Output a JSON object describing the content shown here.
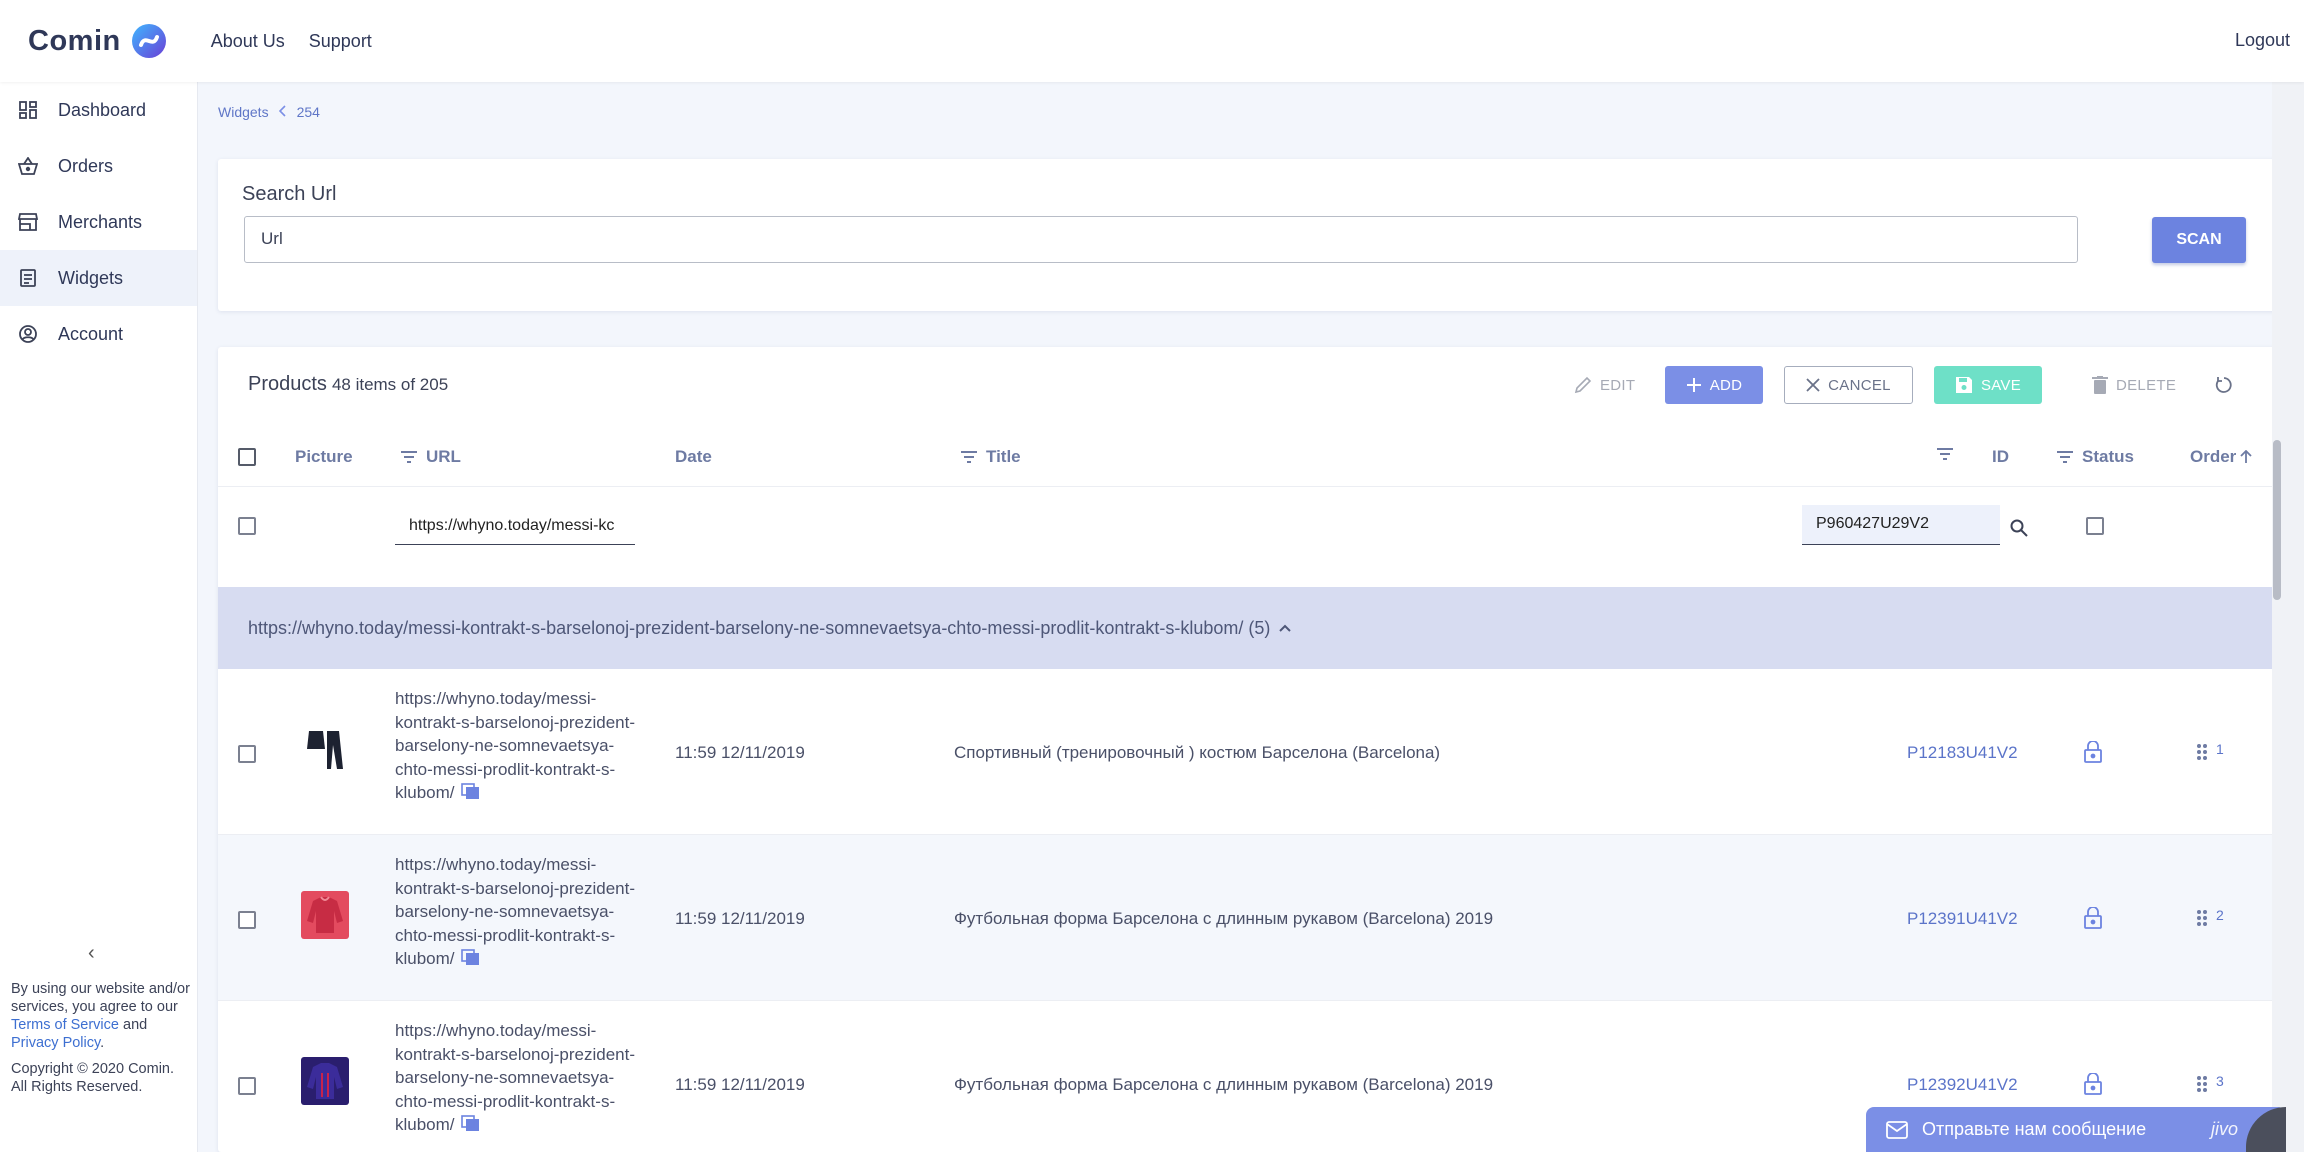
{
  "app": {
    "brand": "Comin",
    "nav": [
      "About Us",
      "Support"
    ],
    "logout": "Logout"
  },
  "sidebar": {
    "items": [
      {
        "label": "Dashboard",
        "icon": "dashboard-icon"
      },
      {
        "label": "Orders",
        "icon": "basket-icon"
      },
      {
        "label": "Merchants",
        "icon": "store-icon"
      },
      {
        "label": "Widgets",
        "icon": "widget-icon",
        "active": true
      },
      {
        "label": "Account",
        "icon": "account-icon"
      }
    ],
    "collapse": "‹",
    "footer": {
      "text1": "By using our website and/or services, you agree to our ",
      "terms": "Terms of Service",
      "and": " and ",
      "privacy": "Privacy Policy",
      "end": ".",
      "copyright": "Copyright © 2020 Comin. All Rights Reserved."
    }
  },
  "breadcrumb": {
    "parent": "Widgets",
    "current": "254"
  },
  "search": {
    "label": "Search Url",
    "placeholder": "Url",
    "button": "SCAN"
  },
  "products": {
    "title": "Products",
    "count": "48 items of 205",
    "toolbar": {
      "edit": "EDIT",
      "add": "ADD",
      "cancel": "CANCEL",
      "save": "SAVE",
      "delete": "DELETE"
    },
    "columns": {
      "picture": "Picture",
      "url": "URL",
      "date": "Date",
      "title": "Title",
      "id": "ID",
      "status": "Status",
      "order": "Order"
    },
    "filters": {
      "url": "https://whyno.today/messi-kc",
      "id": "P960427U29V2"
    },
    "group": {
      "label": "https://whyno.today/messi-kontrakt-s-barselonoj-prezident-barselony-ne-somnevaetsya-chto-messi-prodlit-kontrakt-s-klubom/ (5)"
    },
    "rows": [
      {
        "url": "https://whyno.today/messi-kontrakt-s-barselonoj-prezident-barselony-ne-somnevaetsya-chto-messi-prodlit-kontrakt-s-klubom/",
        "date": "11:59 12/11/2019",
        "title": "Спортивный (тренировочный ) костюм Барселона (Barcelona)",
        "id": "P12183U41V2",
        "order": "1",
        "pic_color": "#1d2231"
      },
      {
        "url": "https://whyno.today/messi-kontrakt-s-barselonoj-prezident-barselony-ne-somnevaetsya-chto-messi-prodlit-kontrakt-s-klubom/",
        "date": "11:59 12/11/2019",
        "title": "Футбольная форма Барселона с длинным рукавом (Barcelona) 2019",
        "id": "P12391U41V2",
        "order": "2",
        "pic_color": "#e34b5f"
      },
      {
        "url": "https://whyno.today/messi-kontrakt-s-barselonoj-prezident-barselony-ne-somnevaetsya-chto-messi-prodlit-kontrakt-s-klubom/",
        "date": "11:59 12/11/2019",
        "title": "Футбольная форма Барселона с длинным рукавом (Barcelona) 2019",
        "id": "P12392U41V2",
        "order": "3",
        "pic_color": "#2a1e6e"
      }
    ]
  },
  "chat": {
    "label": "Отправьте нам сообщение",
    "brand": "jivo"
  },
  "colors": {
    "accent": "#6c83e0",
    "save": "#6ee0c7",
    "group_bg": "#d7dcf1",
    "link": "#5b74c9"
  }
}
